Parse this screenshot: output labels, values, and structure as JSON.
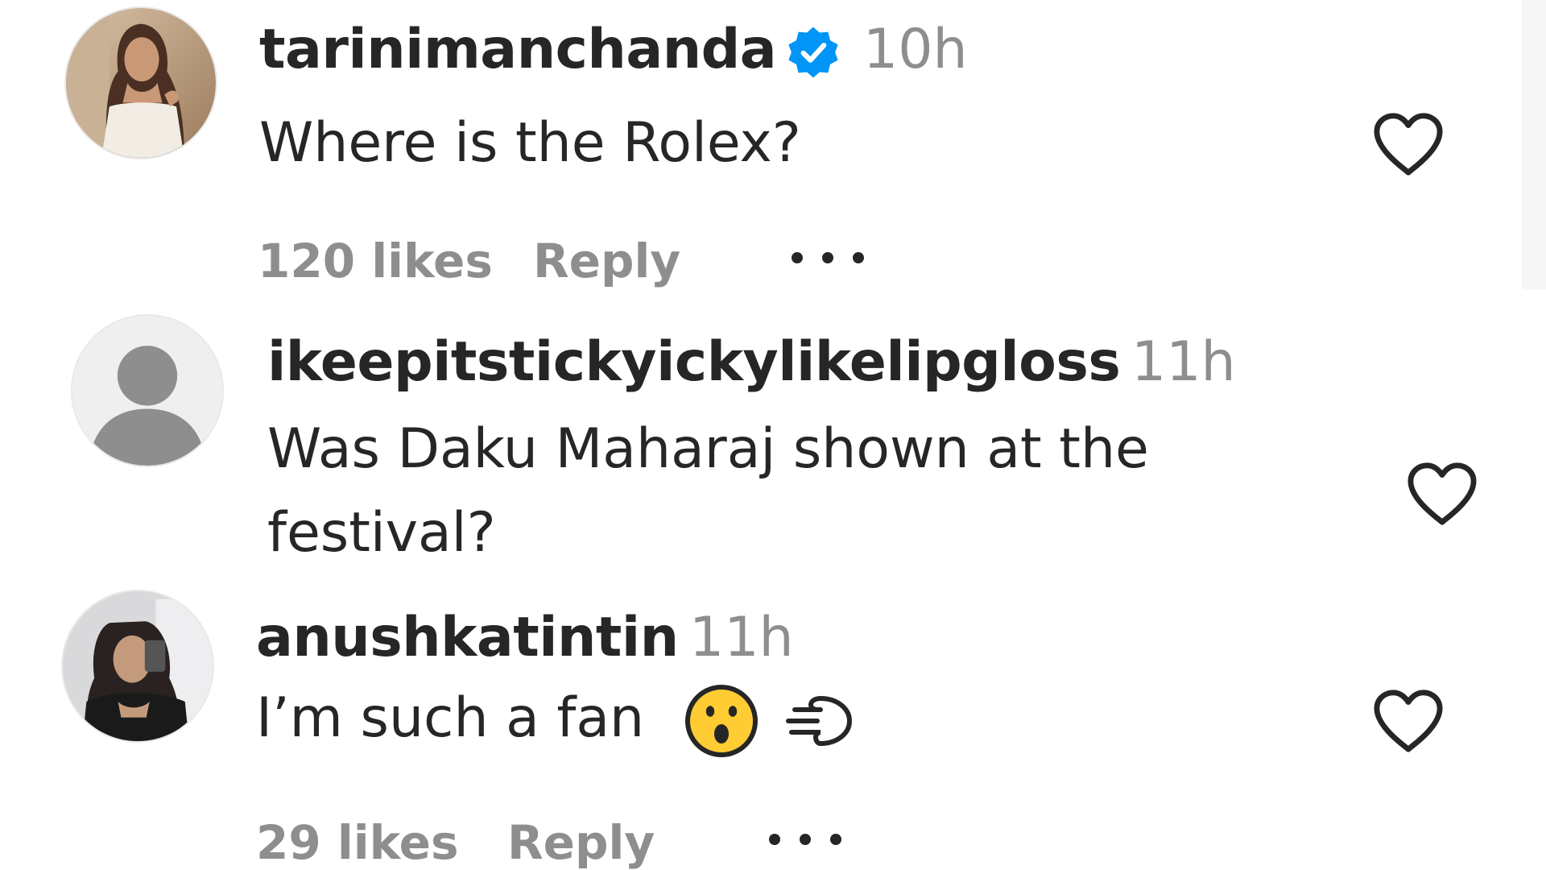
{
  "comments": [
    {
      "username": "tarinimanchanda",
      "verified": true,
      "time": "10h",
      "text": "Where is the Rolex?",
      "likes": "120 likes",
      "reply": "Reply",
      "avatar_icon": "profile-photo-woman-white-dress",
      "like_icon": "heart-outline-icon",
      "more_icon": "more-options-icon"
    },
    {
      "username": "ikeepitstickyickylikelipgloss",
      "verified": false,
      "time": "11h",
      "text_line1": "Was Daku Maharaj shown at the",
      "text_line2": "festival?",
      "avatar_icon": "default-avatar-icon",
      "like_icon": "heart-outline-icon"
    },
    {
      "username": "anushkatintin",
      "verified": false,
      "time": "11h",
      "text": "I’m such a fan",
      "emojis": [
        "hushed-face-emoji",
        "dashing-away-emoji"
      ],
      "likes": "29 likes",
      "reply": "Reply",
      "avatar_icon": "profile-photo-mirror-selfie",
      "like_icon": "heart-outline-icon",
      "more_icon": "more-options-icon"
    }
  ],
  "colors": {
    "text": "#262626",
    "secondary": "#8e8e8e",
    "verified": "#0095f6",
    "emoji_face": "#ffcc33"
  }
}
